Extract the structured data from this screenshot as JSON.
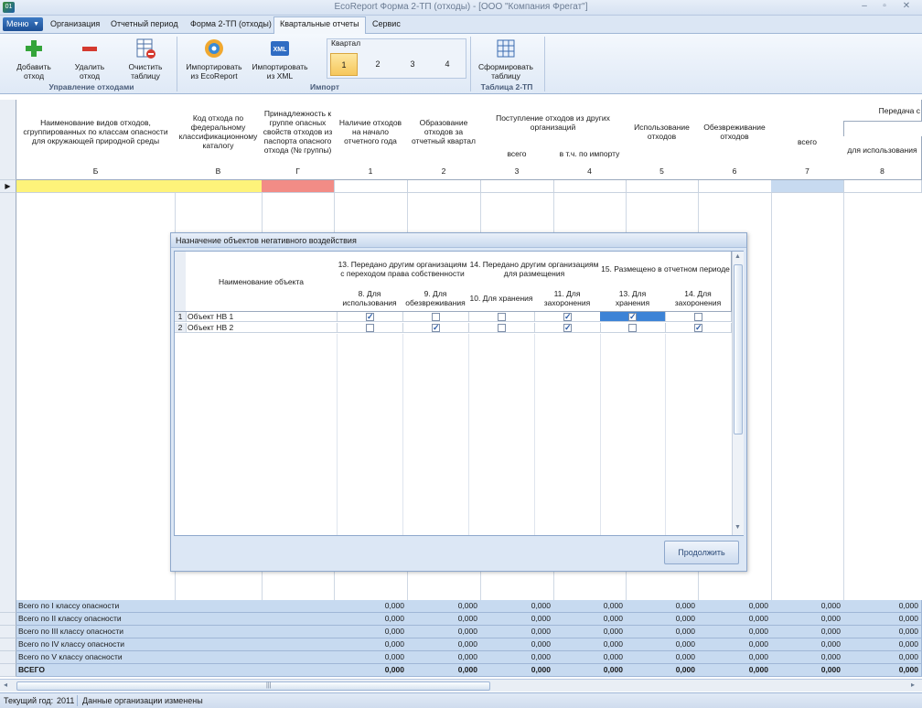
{
  "window": {
    "title": "EcoReport Форма 2-ТП (отходы) - [ООО \"Компания Фрегат\"]",
    "app_icon": "01"
  },
  "tabs": {
    "menu": "Меню",
    "items": [
      "Организация",
      "Отчетный период",
      "Форма 2-ТП (отходы)",
      "Квартальные отчеты",
      "Сервис"
    ],
    "active": "Квартальные отчеты"
  },
  "ribbon": {
    "waste_group": {
      "label": "Управление отходами",
      "add": "Добавить\nотход",
      "delete": "Удалить\nотход",
      "clear": "Очистить\nтаблицу"
    },
    "import_group": {
      "label": "Импорт",
      "import_ecoreport": "Импортировать\nиз EcoReport",
      "import_xml": "Импортировать\nиз XML",
      "xml_icon_text": "XML",
      "quarter_label": "Квартал",
      "quarters": [
        "1",
        "2",
        "3",
        "4"
      ],
      "selected_quarter": "1"
    },
    "table_group": {
      "label": "Таблица 2-ТП",
      "build": "Сформировать\nтаблицу"
    }
  },
  "grid": {
    "headers": {
      "b": "Наименование видов отходов, сгруппированных по классам опасности для окружающей природной среды",
      "v": "Код отхода по федеральному классификационному каталогу",
      "g": "Принадлежность к группе опасных свойств отходов из паспорта опасного отхода (№ группы)",
      "c1": "Наличие отходов на начало отчетного года",
      "c2": "Образование отходов за отчетный квартал",
      "receipt": "Поступление отходов из других организаций",
      "c3": "всего",
      "c4": "в т.ч. по импорту",
      "c5": "Использование отходов",
      "c6": "Обезвреживание отходов",
      "transfer": "Передача с",
      "c7": "всего",
      "c8": "для использования"
    },
    "col_codes": [
      "Б",
      "В",
      "Г",
      "1",
      "2",
      "3",
      "4",
      "5",
      "6",
      "7",
      "8"
    ],
    "totals": [
      {
        "label": "Всего по I классу опасности",
        "values": [
          "0,000",
          "0,000",
          "0,000",
          "0,000",
          "0,000",
          "0,000",
          "0,000",
          "0,000"
        ]
      },
      {
        "label": "Всего по II классу опасности",
        "values": [
          "0,000",
          "0,000",
          "0,000",
          "0,000",
          "0,000",
          "0,000",
          "0,000",
          "0,000"
        ]
      },
      {
        "label": "Всего по III классу опасности",
        "values": [
          "0,000",
          "0,000",
          "0,000",
          "0,000",
          "0,000",
          "0,000",
          "0,000",
          "0,000"
        ]
      },
      {
        "label": "Всего по IV классу опасности",
        "values": [
          "0,000",
          "0,000",
          "0,000",
          "0,000",
          "0,000",
          "0,000",
          "0,000",
          "0,000"
        ]
      },
      {
        "label": "Всего по V классу опасности",
        "values": [
          "0,000",
          "0,000",
          "0,000",
          "0,000",
          "0,000",
          "0,000",
          "0,000",
          "0,000"
        ]
      },
      {
        "label": "ВСЕГО",
        "values": [
          "0,000",
          "0,000",
          "0,000",
          "0,000",
          "0,000",
          "0,000",
          "0,000",
          "0,000"
        ]
      }
    ],
    "colors": {
      "yellow_cell": "#fef37a",
      "red_cell": "#f28c86",
      "blue_cell": "#c7daf0"
    }
  },
  "dialog": {
    "title": "Назначение объектов негативного воздействия",
    "headers": {
      "name": "Наименование объекта",
      "g13": "13. Передано другим организациям с переходом права собственности",
      "g14": "14. Передано другим организациям для размещения",
      "g15": "15. Размещено в отчетном периоде",
      "c1": "8. Для использования",
      "c2": "9. Для обезвреживания",
      "c3": "10. Для хранения",
      "c4": "11. Для захоронения",
      "c5": "13. Для хранения",
      "c6": "14. Для захоронения"
    },
    "rows": [
      {
        "num": "1",
        "name": "Объект НВ 1",
        "checks": [
          true,
          false,
          false,
          true,
          true,
          false
        ]
      },
      {
        "num": "2",
        "name": "Объект НВ 2",
        "checks": [
          false,
          true,
          false,
          true,
          false,
          true
        ]
      }
    ],
    "continue": "Продолжить"
  },
  "status": {
    "year_label": "Текущий год:",
    "year": "2011",
    "message": "Данные организации изменены"
  }
}
